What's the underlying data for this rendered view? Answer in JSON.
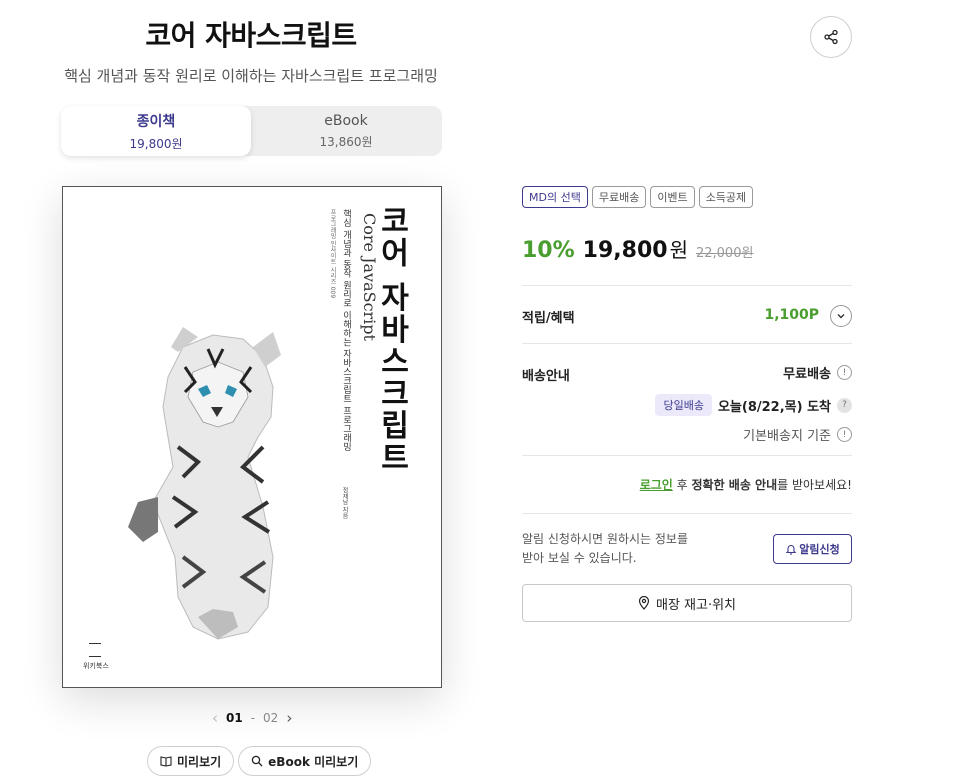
{
  "product": {
    "title": "코어 자바스크립트",
    "subtitle": "핵심 개념과 동작 원리로 이해하는 자바스크립트 프로그래밍"
  },
  "share": {
    "icon": "share-icon"
  },
  "formats": [
    {
      "label": "종이책",
      "price": "19,800원",
      "active": true
    },
    {
      "label": "eBook",
      "price": "13,860원",
      "active": false
    }
  ],
  "cover": {
    "title": "코어 자바스크립트",
    "english_title": "Core JavaScript",
    "subtitle": "핵심 개념과 동작 원리로 이해하는 자바스크립트 프로그래밍",
    "series": "프로그래밍 인사이트 시리즈 009",
    "author": "정재남 지음",
    "publisher": "위키북스"
  },
  "pager": {
    "current": "01",
    "separator": "-",
    "total": "02"
  },
  "preview_buttons": {
    "preview": "미리보기",
    "ebook_preview": "eBook 미리보기"
  },
  "badges": [
    "MD의 선택",
    "무료배송",
    "이벤트",
    "소득공제"
  ],
  "price": {
    "discount": "10%",
    "sale": "19,800",
    "unit": "원",
    "original": "22,000원"
  },
  "benefits": {
    "label": "적립/혜택",
    "points": "1,100P"
  },
  "shipping": {
    "label": "배송안내",
    "free": "무료배송",
    "sameday_tag": "당일배송",
    "arrival": "오늘(8/22,목) 도착",
    "base": "기본배송지 기준"
  },
  "login_notice": {
    "link": "로그인",
    "after": " 후 ",
    "bold": "정확한 배송 안내",
    "end": "를 받아보세요!"
  },
  "notify": {
    "line1": "알림 신청하시면 원하시는 정보를",
    "line2": "받아 보실 수 있습니다.",
    "button": "알림신청"
  },
  "store": {
    "label": "매장 재고·위치"
  },
  "colors": {
    "brand": "#3d3a8e",
    "accent_green": "#4a9d2f"
  }
}
